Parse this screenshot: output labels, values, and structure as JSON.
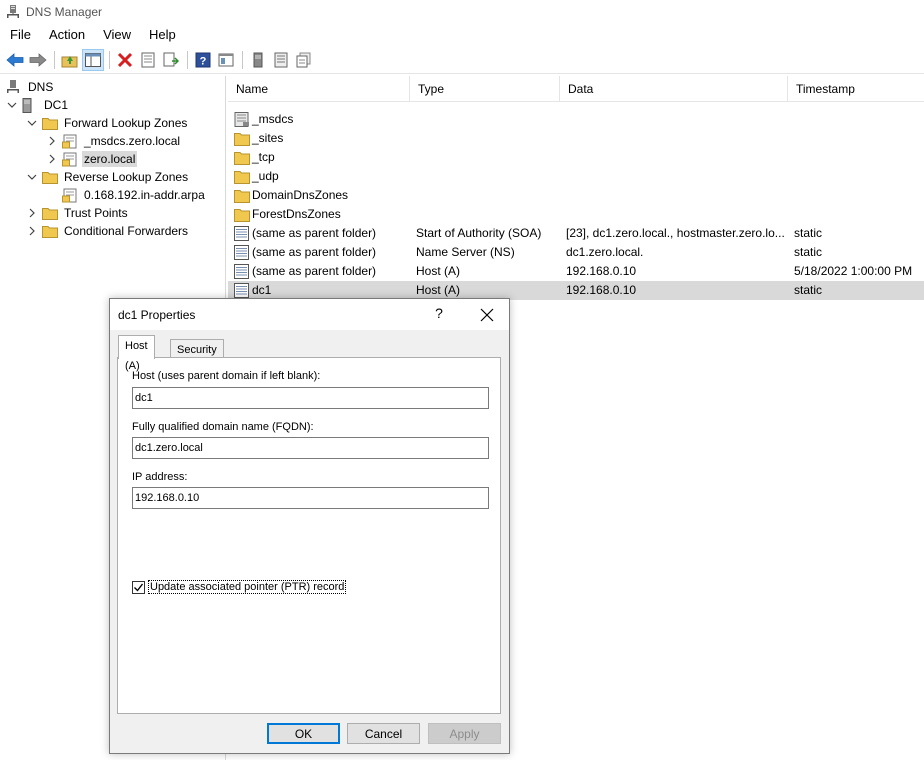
{
  "window": {
    "title": "DNS Manager"
  },
  "menu": [
    "File",
    "Action",
    "View",
    "Help"
  ],
  "toolbar": {
    "icons": [
      "back-arrow-icon",
      "forward-arrow-icon",
      "up-folder-icon",
      "show-hide-tree-icon",
      "delete-icon",
      "properties-icon",
      "export-list-icon",
      "help-icon",
      "console-tree-icon",
      "server-icon",
      "records-icon",
      "copy-records-icon"
    ]
  },
  "tree": {
    "root": "DNS",
    "server": "DC1",
    "forward_zones": "Forward Lookup Zones",
    "msdcs_zone": "_msdcs.zero.local",
    "zero_zone": "zero.local",
    "reverse_zones": "Reverse Lookup Zones",
    "reverse_zone": "0.168.192.in-addr.arpa",
    "trust_points": "Trust Points",
    "conditional_forwarders": "Conditional Forwarders"
  },
  "list": {
    "columns": [
      "Name",
      "Type",
      "Data",
      "Timestamp"
    ],
    "rows": [
      {
        "name": "_msdcs",
        "type": "",
        "data": "",
        "timestamp": "",
        "icon": "delegated-folder-icon"
      },
      {
        "name": "_sites",
        "type": "",
        "data": "",
        "timestamp": "",
        "icon": "folder-icon"
      },
      {
        "name": "_tcp",
        "type": "",
        "data": "",
        "timestamp": "",
        "icon": "folder-icon"
      },
      {
        "name": "_udp",
        "type": "",
        "data": "",
        "timestamp": "",
        "icon": "folder-icon"
      },
      {
        "name": "DomainDnsZones",
        "type": "",
        "data": "",
        "timestamp": "",
        "icon": "folder-icon"
      },
      {
        "name": "ForestDnsZones",
        "type": "",
        "data": "",
        "timestamp": "",
        "icon": "folder-icon"
      },
      {
        "name": "(same as parent folder)",
        "type": "Start of Authority (SOA)",
        "data": "[23], dc1.zero.local., hostmaster.zero.lo...",
        "timestamp": "static",
        "icon": "record-icon"
      },
      {
        "name": "(same as parent folder)",
        "type": "Name Server (NS)",
        "data": "dc1.zero.local.",
        "timestamp": "static",
        "icon": "record-icon"
      },
      {
        "name": "(same as parent folder)",
        "type": "Host (A)",
        "data": "192.168.0.10",
        "timestamp": "5/18/2022 1:00:00 PM",
        "icon": "record-icon"
      },
      {
        "name": "dc1",
        "type": "Host (A)",
        "data": "192.168.0.10",
        "timestamp": "static",
        "icon": "record-icon"
      }
    ]
  },
  "dialog": {
    "title": "dc1 Properties",
    "help": "?",
    "tabs": [
      "Host (A)",
      "Security"
    ],
    "host_label": "Host (uses parent domain if left blank):",
    "host_value": "dc1",
    "fqdn_label": "Fully qualified domain name (FQDN):",
    "fqdn_value": "dc1.zero.local",
    "ip_label": "IP address:",
    "ip_value": "192.168.0.10",
    "ptr_label": "Update associated pointer (PTR) record",
    "ptr_checked": true,
    "ok": "OK",
    "cancel": "Cancel",
    "apply": "Apply"
  }
}
